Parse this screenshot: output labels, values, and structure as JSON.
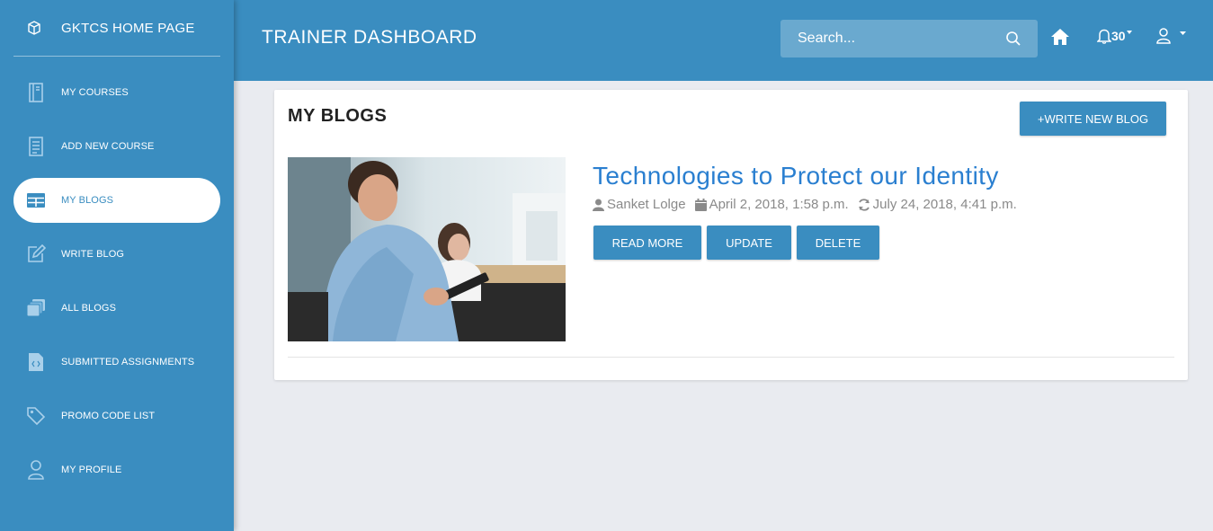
{
  "sidebar": {
    "brand": "GKTCS HOME PAGE",
    "items": [
      {
        "label": "MY COURSES",
        "icon": "book-icon"
      },
      {
        "label": "ADD NEW COURSE",
        "icon": "document-list-icon"
      },
      {
        "label": "MY BLOGS",
        "icon": "table-icon",
        "active": true
      },
      {
        "label": "WRITE BLOG",
        "icon": "edit-icon"
      },
      {
        "label": "ALL BLOGS",
        "icon": "stack-icon"
      },
      {
        "label": "SUBMITTED ASSIGNMENTS",
        "icon": "code-file-icon"
      },
      {
        "label": "PROMO CODE LIST",
        "icon": "tags-icon"
      },
      {
        "label": "MY PROFILE",
        "icon": "user-icon"
      }
    ]
  },
  "header": {
    "title": "TRAINER DASHBOARD",
    "search_placeholder": "Search...",
    "notification_count": "30"
  },
  "main": {
    "title": "MY BLOGS",
    "write_new_label": "+WRITE NEW BLOG",
    "posts": [
      {
        "title": "Technologies to Protect our Identity",
        "author": "Sanket Lolge",
        "created": "April 2, 2018, 1:58 p.m.",
        "updated": "July 24, 2018, 4:41 p.m.",
        "read_more": "READ MORE",
        "update": "UPDATE",
        "delete": "DELETE"
      }
    ]
  },
  "colors": {
    "primary": "#3a8dc0",
    "link": "#2a7fd0",
    "background": "#e9ebf0"
  }
}
